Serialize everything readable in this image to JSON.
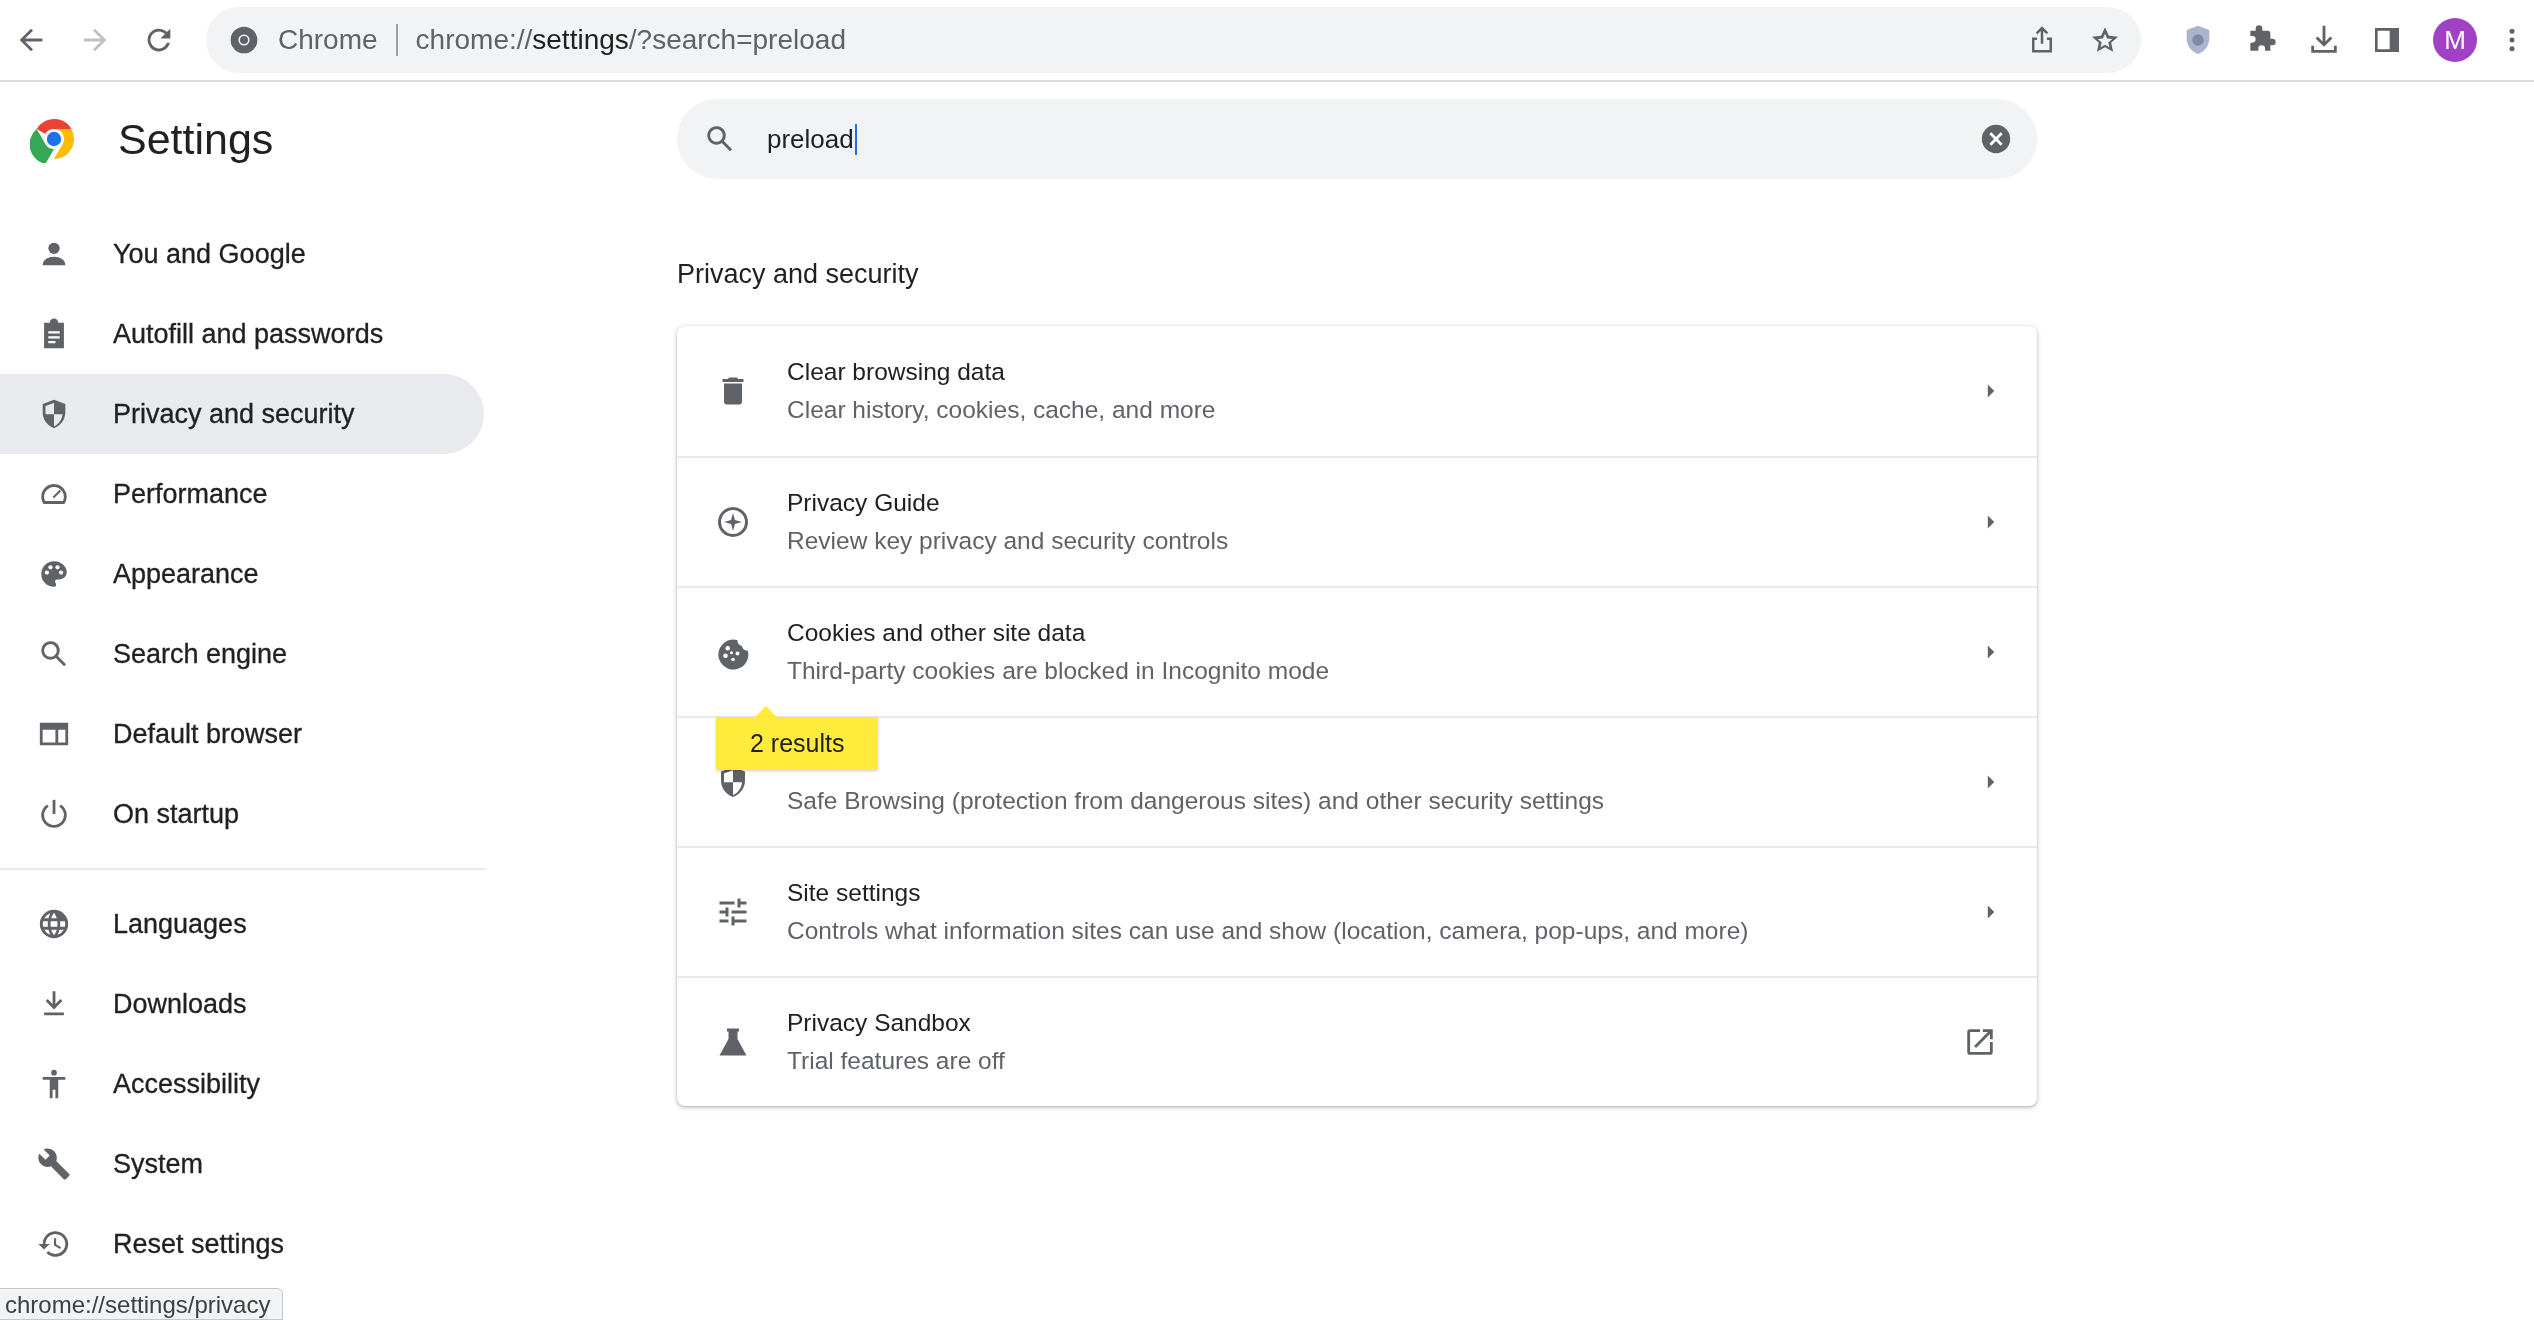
{
  "toolbar": {
    "site_chip": "Chrome",
    "url": {
      "scheme": "chrome://",
      "host": "settings",
      "path": "/?search=preload"
    },
    "avatar": "M"
  },
  "settings": {
    "title": "Settings",
    "search": {
      "value": "preload"
    }
  },
  "sidebar": {
    "groups": [
      [
        {
          "label": "You and Google",
          "selected": false
        },
        {
          "label": "Autofill and passwords",
          "selected": false
        },
        {
          "label": "Privacy and security",
          "selected": true
        },
        {
          "label": "Performance",
          "selected": false
        },
        {
          "label": "Appearance",
          "selected": false
        },
        {
          "label": "Search engine",
          "selected": false
        },
        {
          "label": "Default browser",
          "selected": false
        },
        {
          "label": "On startup",
          "selected": false
        }
      ],
      [
        {
          "label": "Languages",
          "selected": false
        },
        {
          "label": "Downloads",
          "selected": false
        },
        {
          "label": "Accessibility",
          "selected": false
        },
        {
          "label": "System",
          "selected": false
        },
        {
          "label": "Reset settings",
          "selected": false
        }
      ]
    ]
  },
  "section": {
    "heading": "Privacy and security",
    "rows": [
      {
        "title": "Clear browsing data",
        "subtitle": "Clear history, cookies, cache, and more",
        "kind": "arrow"
      },
      {
        "title": "Privacy Guide",
        "subtitle": "Review key privacy and security controls",
        "kind": "arrow"
      },
      {
        "title": "Cookies and other site data",
        "subtitle": "Third-party cookies are blocked in Incognito mode",
        "kind": "arrow"
      },
      {
        "subtitle": "Safe Browsing (protection from dangerous sites) and other security settings",
        "kind": "arrow"
      },
      {
        "title": "Site settings",
        "subtitle": "Controls what information sites can use and show (location, camera, pop-ups, and more)",
        "kind": "arrow"
      },
      {
        "title": "Privacy Sandbox",
        "subtitle": "Trial features are off",
        "kind": "external"
      }
    ],
    "results_bubble": "2 results"
  },
  "status_url": "chrome://settings/privacy"
}
